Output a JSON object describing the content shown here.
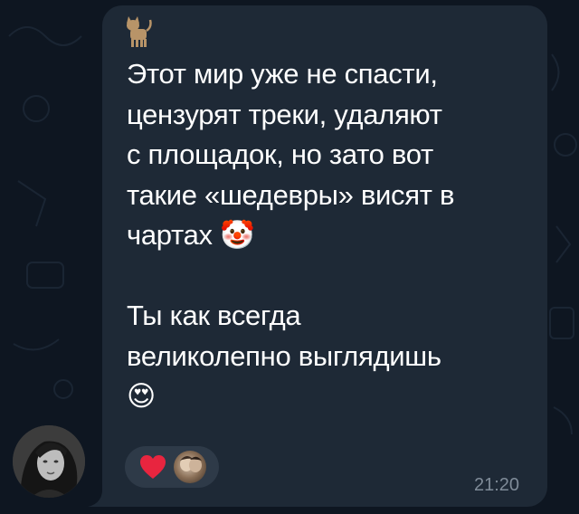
{
  "message": {
    "text": "Этот мир уже не спасти,\nцензурят треки, удаляют\nс площадок, но зато вот\nтакие «шедевры» висят в\nчартах 🤡\n\nТы как всегда\nвеликолепно выглядишь\n😍",
    "time": "21:20"
  },
  "reactions": [
    {
      "emoji": "❤️",
      "icon": "heart-icon"
    }
  ],
  "colors": {
    "background": "#0e1621",
    "bubble": "#1e2936",
    "text": "#ffffff",
    "timestamp": "#7f8b98",
    "reaction_chip": "#2e3a48",
    "heart": "#e8253f"
  }
}
